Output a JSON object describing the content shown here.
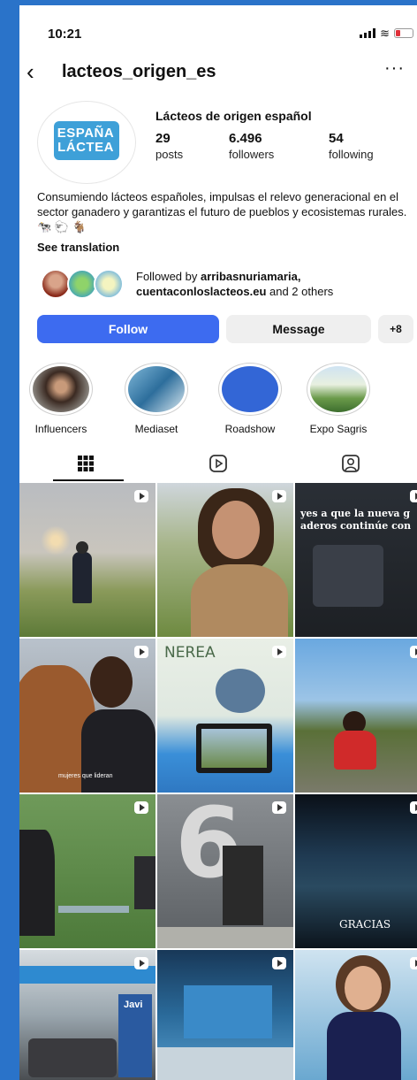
{
  "status_bar": {
    "time": "10:21"
  },
  "header": {
    "username": "lacteos_origen_es",
    "more_label": "···"
  },
  "profile": {
    "logo_line1": "ESPAÑA",
    "logo_line2": "LÁCTEA",
    "full_name": "Lácteos de origen español",
    "stats": [
      {
        "number": "29",
        "label": "posts"
      },
      {
        "number": "6.496",
        "label": "followers"
      },
      {
        "number": "54",
        "label": "following"
      }
    ],
    "bio": "Consumiendo lácteos españoles, impulsas el relevo generacional en el sector ganadero y garantizas el futuro de pueblos y ecosistemas rurales. 🐄 🐑 🐐",
    "see_translation": "See translation",
    "followed_by_prefix": "Followed by ",
    "followed_by_names": "arribasnuriamaria, cuentaconloslacteos.eu",
    "followed_by_suffix": " and 2 others"
  },
  "actions": {
    "follow": "Follow",
    "message": "Message",
    "add_user": "+8"
  },
  "highlights": [
    {
      "label": "Influencers"
    },
    {
      "label": "Mediaset"
    },
    {
      "label": "Roadshow"
    },
    {
      "label": "Expo Sagris"
    }
  ],
  "tabs": [
    {
      "name": "grid"
    },
    {
      "name": "reels"
    },
    {
      "name": "tagged"
    }
  ],
  "grid_text": {
    "cell3_line1": "yes a que la nueva g",
    "cell3_line2": "aderos continúe con",
    "cell5_title": "NEREA",
    "cell4_caption": "mujeres que lideran",
    "cell7_number": "6",
    "cell9_text": "GRACIAS",
    "cell10_text": "Javi"
  },
  "colors": {
    "accent": "#3d6bf0",
    "frame_blue": "#2a73c9"
  }
}
